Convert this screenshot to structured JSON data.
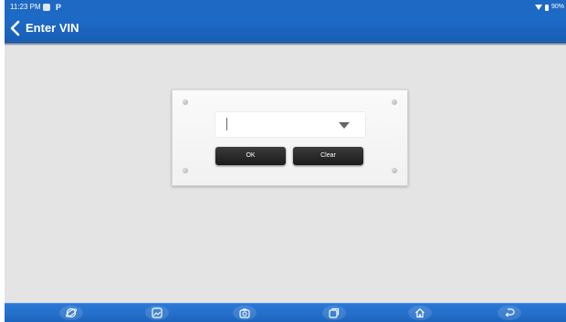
{
  "status_bar": {
    "time": "11:23 PM",
    "notification_letter": "P",
    "battery_text": "90%"
  },
  "title_bar": {
    "title": "Enter VIN"
  },
  "dialog": {
    "vin_value": "",
    "ok_label": "OK",
    "clear_label": "Clear"
  },
  "nav_bar": {
    "items": [
      "browser-icon",
      "gallery-icon",
      "screenshot-icon",
      "recent-apps-icon",
      "home-icon",
      "back-icon"
    ]
  },
  "colors": {
    "header_blue": "#1d69c4",
    "background_gray": "#e4e4e4",
    "button_dark": "#2a2a2a",
    "nav_blue": "#2570cb"
  }
}
